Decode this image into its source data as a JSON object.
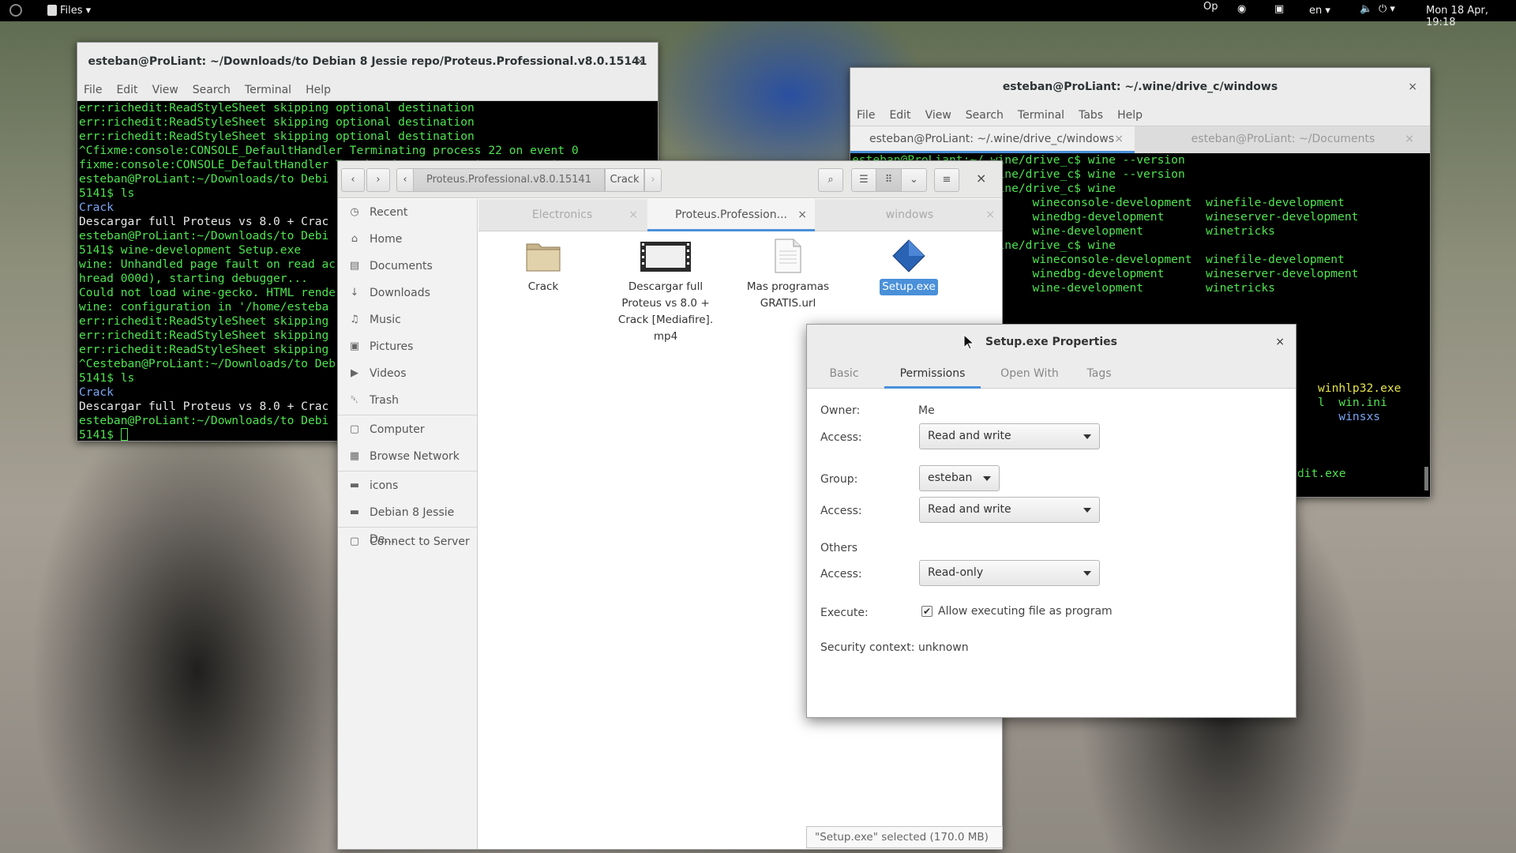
{
  "topbar": {
    "app_menu": "Files",
    "indicators": [
      "Op",
      "en"
    ],
    "clock": "Mon 18 Apr, 19:18"
  },
  "term_left": {
    "title": "esteban@ProLiant: ~/Downloads/to Debian 8 Jessie repo/Proteus.Professional.v8.0.15141",
    "menu": [
      "File",
      "Edit",
      "View",
      "Search",
      "Terminal",
      "Help"
    ],
    "lines": [
      {
        "t": "err:richedit:ReadStyleSheet skipping optional destination",
        "c": "g"
      },
      {
        "t": "err:richedit:ReadStyleSheet skipping optional destination",
        "c": "g"
      },
      {
        "t": "err:richedit:ReadStyleSheet skipping optional destination",
        "c": "g"
      },
      {
        "t": "^Cfixme:console:CONSOLE_DefaultHandler Terminating process 22 on event 0",
        "c": "g"
      },
      {
        "t": "fixme:console:CONSOLE_DefaultHandler Terminating process 0 on event 0",
        "c": "g"
      },
      {
        "t": "esteban@ProLiant:~/Downloads/to Debi",
        "c": "g"
      },
      {
        "t": "5141$ ls",
        "c": "g"
      },
      {
        "t": "Crack",
        "c": "b"
      },
      {
        "t": "Descargar full Proteus vs 8.0 + Crac",
        "c": "w"
      },
      {
        "t": "esteban@ProLiant:~/Downloads/to Debi",
        "c": "g"
      },
      {
        "t": "5141$ wine-development Setup.exe",
        "c": "g"
      },
      {
        "t": "wine: Unhandled page fault on read ac",
        "c": "g"
      },
      {
        "t": "hread 000d), starting debugger...",
        "c": "g"
      },
      {
        "t": "Could not load wine-gecko. HTML rende",
        "c": "g"
      },
      {
        "t": "wine: configuration in '/home/esteba",
        "c": "g"
      },
      {
        "t": "err:richedit:ReadStyleSheet skipping",
        "c": "g"
      },
      {
        "t": "err:richedit:ReadStyleSheet skipping",
        "c": "g"
      },
      {
        "t": "err:richedit:ReadStyleSheet skipping",
        "c": "g"
      },
      {
        "t": "^Cesteban@ProLiant:~/Downloads/to Deb",
        "c": "g"
      },
      {
        "t": "5141$ ls",
        "c": "g"
      },
      {
        "t": "Crack",
        "c": "b"
      },
      {
        "t": "Descargar full Proteus vs 8.0 + Crac",
        "c": "w"
      },
      {
        "t": "esteban@ProLiant:~/Downloads/to Debi",
        "c": "g"
      },
      {
        "t": "5141$ ",
        "c": "g"
      }
    ]
  },
  "term_right": {
    "title": "esteban@ProLiant: ~/.wine/drive_c/windows",
    "menu": [
      "File",
      "Edit",
      "View",
      "Search",
      "Terminal",
      "Tabs",
      "Help"
    ],
    "tabs": [
      {
        "label": "esteban@ProLiant: ~/.wine/drive_c/windows"
      },
      {
        "label": "esteban@ProLiant: ~/Documents"
      }
    ],
    "lines": [
      {
        "t": "esteban@ProLiant:~/.wine/drive_c$ wine --version",
        "c": "g"
      },
      {
        "t": "",
        "c": "g"
      },
      {
        "t": "esteban@ProLiant:~/.wine/drive_c$ wine --version",
        "c": "g"
      },
      {
        "t": "",
        "c": "g"
      },
      {
        "t": "esteban@ProLiant:~/.wine/drive_c$ wine",
        "c": "g"
      },
      {
        "t": "wine                      wineconsole-development  winefile-development",
        "c": "g"
      },
      {
        "t": "wineboot                  winedbg-development      wineserver-development",
        "c": "g"
      },
      {
        "t": "winecfg                   wine-development         winetricks",
        "c": "g"
      },
      {
        "t": "esteban@ProLiant:~/.wine/drive_c$ wine",
        "c": "g"
      },
      {
        "t": "wine                      wineconsole-development  winefile-development",
        "c": "g"
      },
      {
        "t": "wineboot                  winedbg-development      wineserver-development",
        "c": "g"
      },
      {
        "t": "winecfg                   wine-development         winetricks",
        "c": "g"
      }
    ],
    "right_listing": [
      {
        "t": "winhlp32.exe",
        "c": "y"
      },
      {
        "t": "l  win.ini",
        "c": "g"
      },
      {
        "t": "   winsxs",
        "c": "b"
      }
    ],
    "bottom_listing": "dit.exe"
  },
  "files": {
    "path": [
      "Proteus.Professional.v8.0.15141",
      "Crack"
    ],
    "sidebar": [
      {
        "label": "Recent",
        "icon": "◷",
        "name": "sidebar-item-recent"
      },
      {
        "label": "Home",
        "icon": "⌂",
        "name": "sidebar-item-home"
      },
      {
        "label": "Documents",
        "icon": "▤",
        "name": "sidebar-item-documents"
      },
      {
        "label": "Downloads",
        "icon": "↓",
        "name": "sidebar-item-downloads"
      },
      {
        "label": "Music",
        "icon": "♫",
        "name": "sidebar-item-music"
      },
      {
        "label": "Pictures",
        "icon": "▣",
        "name": "sidebar-item-pictures"
      },
      {
        "label": "Videos",
        "icon": "▶",
        "name": "sidebar-item-videos"
      },
      {
        "label": "Trash",
        "icon": "␡",
        "name": "sidebar-item-trash"
      },
      {
        "label": "Computer",
        "icon": "▢",
        "name": "sidebar-item-computer"
      },
      {
        "label": "Browse Network",
        "icon": "▦",
        "name": "sidebar-item-network"
      },
      {
        "label": "icons",
        "icon": "▬",
        "name": "sidebar-item-icons"
      },
      {
        "label": "Debian 8 Jessie De...",
        "icon": "▬",
        "name": "sidebar-item-debian"
      },
      {
        "label": "Connect to Server",
        "icon": "▢",
        "name": "sidebar-item-connect"
      }
    ],
    "tabs": [
      {
        "label": "Electronics"
      },
      {
        "label": "Proteus.Profession..."
      },
      {
        "label": "windows"
      }
    ],
    "items": [
      {
        "label": "Crack",
        "type": "folder"
      },
      {
        "label": "Descargar full Proteus vs 8.0 + Crack [Mediafire]. mp4",
        "type": "video"
      },
      {
        "label": "Mas programas GRATIS.url",
        "type": "document"
      },
      {
        "label": "Setup.exe",
        "type": "executable",
        "selected": true
      }
    ],
    "status": "\"Setup.exe\" selected (170.0 MB)"
  },
  "props": {
    "title": "Setup.exe Properties",
    "tabs": [
      "Basic",
      "Permissions",
      "Open With",
      "Tags"
    ],
    "owner_label": "Owner:",
    "owner": "Me",
    "access_label": "Access:",
    "owner_access": "Read and write",
    "group_label": "Group:",
    "group": "esteban",
    "group_access": "Read and write",
    "others_label": "Others",
    "others_access": "Read-only",
    "execute_label": "Execute:",
    "execute_text": "Allow executing file as program",
    "execute_checked": true,
    "security_label": "Security context:",
    "security": "unknown"
  },
  "colors": {
    "accent": "#4a90d9",
    "terminal_green": "#4fe44f"
  }
}
